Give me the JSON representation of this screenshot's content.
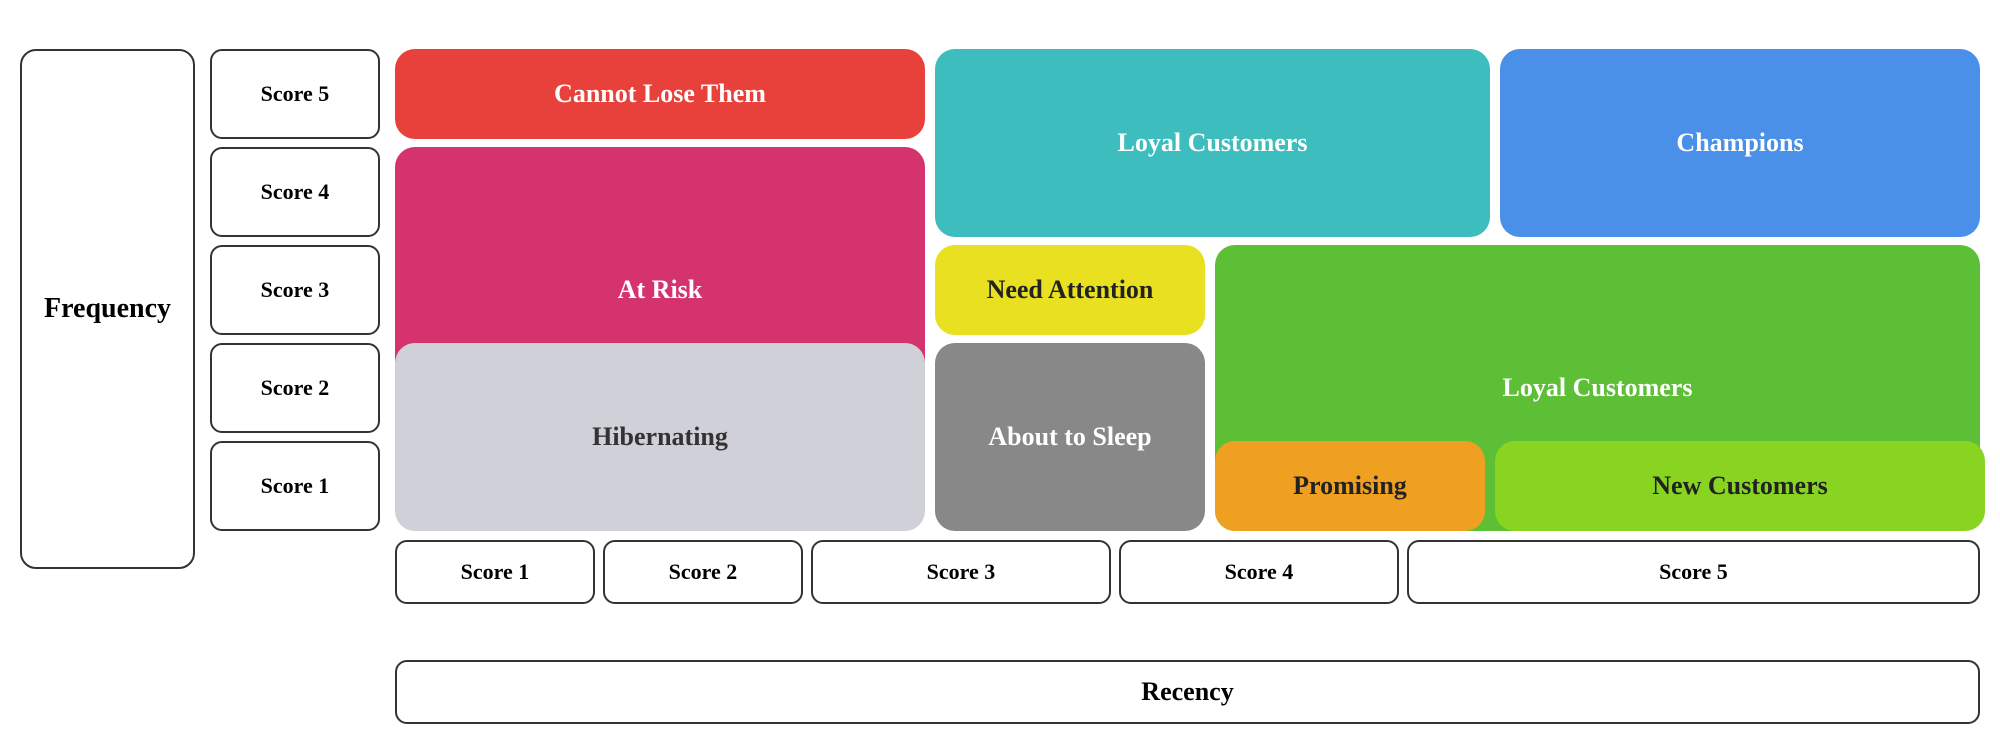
{
  "labels": {
    "frequency": "Frequency",
    "recency": "Recency"
  },
  "score_vertical": [
    "Score 5",
    "Score 4",
    "Score 3",
    "Score 2",
    "Score 1"
  ],
  "score_horizontal": [
    "Score 1",
    "Score 2",
    "Score 3",
    "Score 4",
    "Score 5"
  ],
  "segments": {
    "cannot_lose": "Cannot Lose Them",
    "loyal_customers_top": "Loyal Customers",
    "champions": "Champions",
    "at_risk": "At Risk",
    "need_attention": "Need Attention",
    "loyal_customers_right": "Loyal Customers",
    "hibernating": "Hibernating",
    "about_to_sleep": "About to Sleep",
    "promising": "Promising",
    "new_customers": "New Customers"
  },
  "colors": {
    "cannot_lose": "#e8413c",
    "loyal_customers_top": "#3dbdbe",
    "champions": "#4a8fe8",
    "at_risk": "#d4336e",
    "need_attention": "#e8e020",
    "loyal_customers_right": "#5cbf35",
    "hibernating": "#d0d0d8",
    "about_to_sleep": "#888888",
    "promising": "#f0a020",
    "new_customers": "#88d420",
    "text_dark": "#222222",
    "text_light": "#ffffff"
  }
}
